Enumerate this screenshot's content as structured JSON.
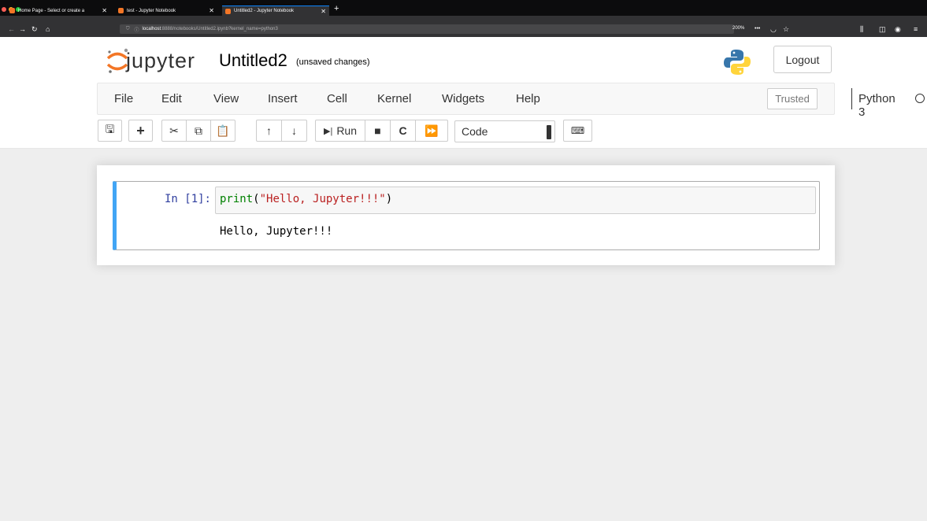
{
  "browser": {
    "tabs": [
      {
        "title": "Home Page - Select or create a",
        "active": false
      },
      {
        "title": "test - Jupyter Notebook",
        "active": false
      },
      {
        "title": "Untitled2 - Jupyter Notebook",
        "active": true
      }
    ],
    "url_host": "localhost",
    "url_rest": ":8888/notebooks/Untitled2.ipynb?kernel_name=python3",
    "zoom": "200%"
  },
  "header": {
    "logo_text": "jupyter",
    "notebook_name": "Untitled2",
    "save_status": "(unsaved changes)",
    "logout_label": "Logout"
  },
  "menu": {
    "items": [
      "File",
      "Edit",
      "View",
      "Insert",
      "Cell",
      "Kernel",
      "Widgets",
      "Help"
    ],
    "trusted_label": "Trusted",
    "kernel_name": "Python 3"
  },
  "toolbar": {
    "run_label": "Run",
    "cell_type": "Code"
  },
  "cell": {
    "prompt": "In [1]:",
    "code_builtin": "print",
    "code_open": "(",
    "code_string": "\"Hello, Jupyter!!!\"",
    "code_close": ")",
    "output": "Hello, Jupyter!!!"
  },
  "colors": {
    "cell_selected_border": "#42a5f5",
    "prompt_color": "#303f9f",
    "builtin_color": "#008000",
    "string_color": "#ba2121"
  }
}
